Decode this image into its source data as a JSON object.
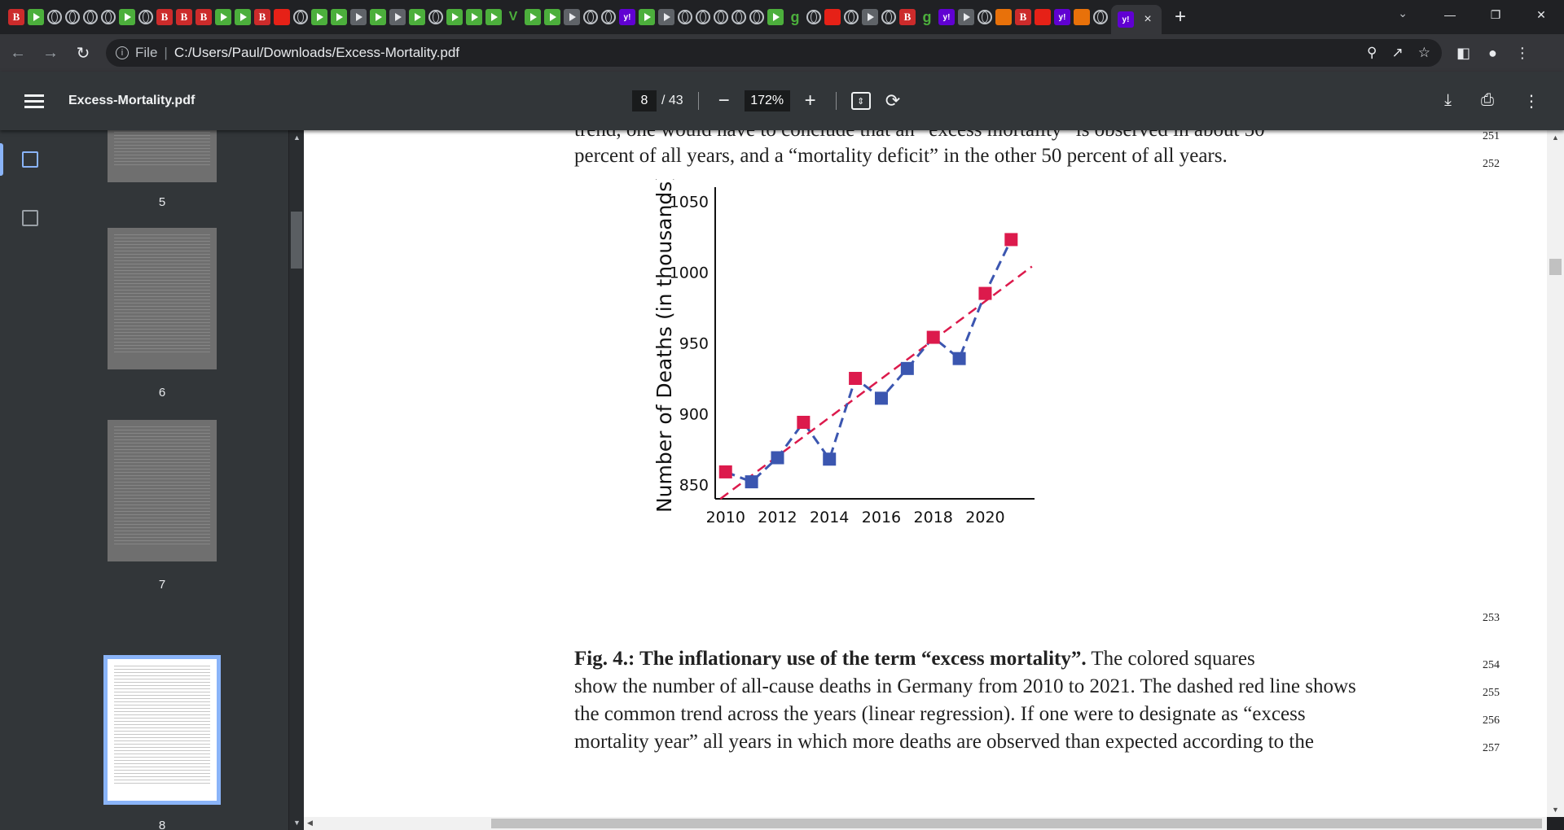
{
  "browser": {
    "tab_icons": [
      "B",
      "play",
      "globe",
      "globe",
      "globe",
      "globe",
      "play",
      "globe",
      "B",
      "B",
      "B",
      "play",
      "play",
      "B",
      "red",
      "globe",
      "play",
      "play",
      "grey",
      "play",
      "grey",
      "play",
      "globe",
      "play",
      "play",
      "play",
      "v",
      "play",
      "play",
      "grey",
      "globe",
      "globe",
      "y",
      "play",
      "grid",
      "globe",
      "globe",
      "globe",
      "globe",
      "globe",
      "play",
      "g",
      "globe",
      "red",
      "globe",
      "grey",
      "globe",
      "B",
      "g",
      "y",
      "grey",
      "globe",
      "orange",
      "B",
      "red",
      "y",
      "orange",
      "globe",
      "y"
    ],
    "active_tab_close": "×",
    "new_tab": "+",
    "address": {
      "scheme_label": "File",
      "path": "C:/Users/Paul/Downloads/Excess-Mortality.pdf"
    }
  },
  "pdf_toolbar": {
    "title": "Excess-Mortality.pdf",
    "current_page": "8",
    "total_pages": "/ 43",
    "zoom": "172%"
  },
  "sidebar": {
    "thumbnails": [
      {
        "label": "5"
      },
      {
        "label": "6"
      },
      {
        "label": "7"
      },
      {
        "label": "8"
      }
    ]
  },
  "document": {
    "lines_top": [
      {
        "text": "trend, one would have to conclude that an “excess mortality” is observed in about 50",
        "lineno": "251"
      },
      {
        "text": "percent of all years, and a “mortality deficit” in the other 50 percent of all years.",
        "lineno": "252"
      }
    ],
    "chart_lineno": "253",
    "caption_bold": "Fig. 4.: The inflationary use of the term “excess mortality”.",
    "caption_rest_first": " The colored squares",
    "caption_lines": [
      {
        "text": "show the number of all-cause deaths in Germany from 2010 to 2021. The dashed red line shows",
        "lineno": "255"
      },
      {
        "text": "the common trend across the years (linear regression). If one were to designate as “excess",
        "lineno": "256"
      },
      {
        "text": "mortality year” all years in which more deaths are observed than expected according to the",
        "lineno": "257"
      }
    ],
    "caption_first_lineno": "254"
  },
  "chart_data": {
    "type": "scatter",
    "x": [
      2010,
      2011,
      2012,
      2013,
      2014,
      2015,
      2016,
      2017,
      2018,
      2019,
      2020,
      2021
    ],
    "values": [
      859,
      852,
      869,
      894,
      868,
      925,
      911,
      932,
      954,
      939,
      985,
      1023
    ],
    "above_trend": [
      true,
      false,
      false,
      true,
      false,
      true,
      false,
      false,
      true,
      false,
      true,
      true
    ],
    "trend_line": {
      "x": [
        2009.8,
        2021.8
      ],
      "y": [
        840,
        1004
      ]
    },
    "ylabel": "Number of Deaths (in thousands)",
    "xlabel": "",
    "xticks": [
      2010,
      2012,
      2014,
      2016,
      2018,
      2020
    ],
    "yticks": [
      850,
      900,
      950,
      1000,
      1050
    ],
    "ylim": [
      840,
      1060
    ],
    "xlim": [
      2009.6,
      2021.9
    ],
    "colors": {
      "above": "#dc1a4c",
      "below": "#3b56b0",
      "trend": "#dc1a4c",
      "connect": "#3b56b0"
    },
    "grid": false
  }
}
